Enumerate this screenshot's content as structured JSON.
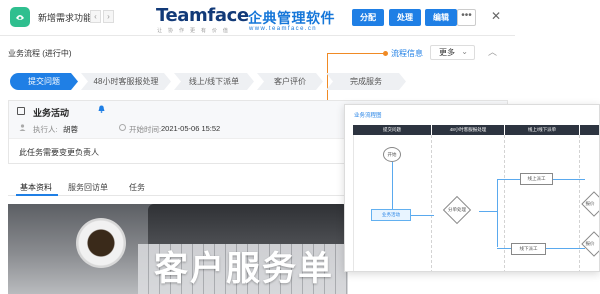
{
  "header": {
    "app_title": "新增需求功能",
    "nav_prev": "‹",
    "nav_next": "›",
    "brand_en": "Teamface",
    "brand_sub": "让 协 作 更 有 价 值",
    "brand_cn": "企典管理软件",
    "brand_url": "www.teamface.cn",
    "actions": [
      "分配",
      "处理",
      "编辑"
    ],
    "more": "•••",
    "close": "✕"
  },
  "process": {
    "label": "业务流程 (进行中)",
    "info_link": "流程信息",
    "more_select": "更多",
    "more_caret": "⌄",
    "collapse": "︿",
    "steps": [
      "提交问题",
      "48小时客服报处理",
      "线上/线下派单",
      "客户评价",
      "完成服务"
    ],
    "active_step": 0
  },
  "task": {
    "name": "业务活动",
    "assignee_label": "执行人:",
    "assignee": "胡蓉",
    "start_label": "开始时间:",
    "start_time": "2021-05-06 15:52",
    "description": "此任务需要变更负责人"
  },
  "tabs": [
    "基本资料",
    "服务回访单",
    "任务"
  ],
  "hero": {
    "text": "客户服务单"
  },
  "flow_popup": {
    "title": "业务流程图",
    "lanes": [
      "提交问题",
      "48小时客服报处理",
      "线上/线下派单",
      ""
    ],
    "nodes": {
      "start": "开始",
      "activity": "业务活动",
      "decision": "分单处理",
      "online": "线上派工",
      "offline": "线下派工",
      "right1": "报价",
      "right2": "报价"
    }
  },
  "colors": {
    "primary": "#1f7fe5",
    "brand_navy": "#123a78",
    "app_icon": "#2fbf8f",
    "highlight": "#f08a24"
  }
}
